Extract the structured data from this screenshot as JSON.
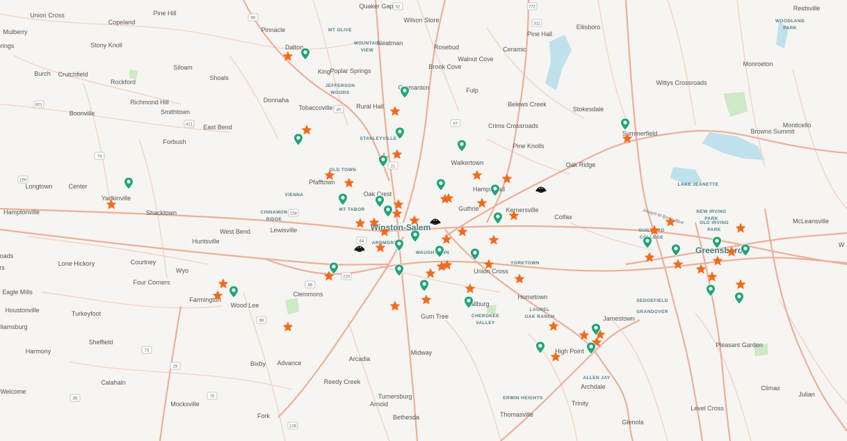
{
  "colors": {
    "background": "#f6f5f2",
    "road": "#f1c7b4",
    "highway": "#edae98",
    "water": "#bfe1ec",
    "park": "#cde9c5",
    "star": "#f26a1b",
    "pin": "#23a477",
    "pin_inner": "#ffffff",
    "bowl": "#111111",
    "neighborhood": "#4f7e85"
  },
  "cities": [
    {
      "name": "Winston-Salem"
    },
    {
      "name": "Greensboro"
    }
  ],
  "towns": [
    {
      "name": "Union Cross"
    },
    {
      "name": "Quaker Gap"
    },
    {
      "name": "Wilson Store"
    },
    {
      "name": "Reidsville"
    },
    {
      "name": "Mulberry"
    },
    {
      "name": "Copeland"
    },
    {
      "name": "Pine Hill"
    },
    {
      "name": "Pinnacle"
    },
    {
      "name": "Pine Hall"
    },
    {
      "name": "Ellisboro"
    },
    {
      "name": "prings"
    },
    {
      "name": "Stony Knoll"
    },
    {
      "name": "Dalton"
    },
    {
      "name": "Neatman"
    },
    {
      "name": "Rosebud"
    },
    {
      "name": "Ceramic"
    },
    {
      "name": "King"
    },
    {
      "name": "Poplar Springs"
    },
    {
      "name": "Walnut Cove"
    },
    {
      "name": "Brook Cove"
    },
    {
      "name": "Monroeton"
    },
    {
      "name": "Burch"
    },
    {
      "name": "Crutchfield"
    },
    {
      "name": "Siloam"
    },
    {
      "name": "Shoals"
    },
    {
      "name": "Rockford"
    },
    {
      "name": "Wittys Crossroads"
    },
    {
      "name": "Germanton"
    },
    {
      "name": "Fulp"
    },
    {
      "name": "Richmond Hill"
    },
    {
      "name": "Donnaha"
    },
    {
      "name": "Rural Hall"
    },
    {
      "name": "Tobaccoville"
    },
    {
      "name": "Belews Creek"
    },
    {
      "name": "Stokesdale"
    },
    {
      "name": "Boonville"
    },
    {
      "name": "Smithtown"
    },
    {
      "name": "Crims Crossroads"
    },
    {
      "name": "East Bend"
    },
    {
      "name": "Summerfield"
    },
    {
      "name": "Browns Summit"
    },
    {
      "name": "Monticello"
    },
    {
      "name": "Forbush"
    },
    {
      "name": "Pine Knolls"
    },
    {
      "name": "Walkertown"
    },
    {
      "name": "Oak Ridge"
    },
    {
      "name": "Longtown"
    },
    {
      "name": "Center"
    },
    {
      "name": "Yadkinville"
    },
    {
      "name": "Pfafftown"
    },
    {
      "name": "Hampstead"
    },
    {
      "name": "Oak Crest"
    },
    {
      "name": "Guthrie"
    },
    {
      "name": "Hamptonville"
    },
    {
      "name": "Shacktown"
    },
    {
      "name": "Kernersville"
    },
    {
      "name": "Colfax"
    },
    {
      "name": "McLeansville"
    },
    {
      "name": "Lewisville"
    },
    {
      "name": "West Bend"
    },
    {
      "name": "Huntsville"
    },
    {
      "name": "Lone Hickory"
    },
    {
      "name": "Courtney"
    },
    {
      "name": "Wyo"
    },
    {
      "name": "Four Corners"
    },
    {
      "name": "Union Cross"
    },
    {
      "name": "Eagle Mills"
    },
    {
      "name": "Clemmons"
    },
    {
      "name": "Hometown"
    },
    {
      "name": "Farmington"
    },
    {
      "name": "Wood Lee"
    },
    {
      "name": "Houstonville"
    },
    {
      "name": "Turkeyfoot"
    },
    {
      "name": "illiamsburg"
    },
    {
      "name": "Gum Tree"
    },
    {
      "name": "Jamestown"
    },
    {
      "name": "Sheffield"
    },
    {
      "name": "High Point"
    },
    {
      "name": "Pleasant Garden"
    },
    {
      "name": "Harmony"
    },
    {
      "name": "Bixby"
    },
    {
      "name": "Advance"
    },
    {
      "name": "Midway"
    },
    {
      "name": "Arcadia"
    },
    {
      "name": "Archdale"
    },
    {
      "name": "Climax"
    },
    {
      "name": "Calahaln"
    },
    {
      "name": "Reedy Creek"
    },
    {
      "name": "Turnersburg"
    },
    {
      "name": "Welcome"
    },
    {
      "name": "Julian"
    },
    {
      "name": "Mocksville"
    },
    {
      "name": "Arnold"
    },
    {
      "name": "Trinity"
    },
    {
      "name": "Level Cross"
    },
    {
      "name": "Fork"
    },
    {
      "name": "Bethesda"
    },
    {
      "name": "Thomasville"
    },
    {
      "name": "Glenola"
    },
    {
      "name": "Wallburg"
    },
    {
      "name": "W"
    },
    {
      "name": "roads"
    },
    {
      "name": "rs"
    }
  ],
  "neighborhoods": [
    {
      "name": "MT OLIVE"
    },
    {
      "name": "MOUNTAIN\nVIEW"
    },
    {
      "name": "WOODLAND\nPARK"
    },
    {
      "name": "JEFFERSON\nWOODS"
    },
    {
      "name": "STANLEYVILLE"
    },
    {
      "name": "OLD TOWN"
    },
    {
      "name": "VIENNA"
    },
    {
      "name": "LAKE JEANETTE"
    },
    {
      "name": "MT TABOR"
    },
    {
      "name": "NEW IRVING\nPARK"
    },
    {
      "name": "CINNAMON\nRIDGE"
    },
    {
      "name": "OLD IRVING\nPARK"
    },
    {
      "name": "GUILFORD\nCOLLEGE"
    },
    {
      "name": "ARDMORE"
    },
    {
      "name": "WAUGHTOWN"
    },
    {
      "name": "YORKTOWN"
    },
    {
      "name": "SEDGEFIELD"
    },
    {
      "name": "GRANDOVER"
    },
    {
      "name": "LAUREL\nOAK RANCH"
    },
    {
      "name": "CHEROKEE\nVALLEY"
    },
    {
      "name": "ALLEN JAY"
    },
    {
      "name": "ERWIN HEIGHTS"
    }
  ],
  "road_labels": [
    {
      "name": "Joseph M Bryan Blvd"
    }
  ],
  "route_shields": [
    "52",
    "772",
    "311",
    "65",
    "67",
    "21",
    "601",
    "421",
    "40",
    "150",
    "74",
    "158",
    "64",
    "66",
    "220",
    "68",
    "29",
    "73",
    "85",
    "70",
    "109"
  ],
  "markers": {
    "star_icon": "star-icon",
    "pin_icon": "location-pin-icon",
    "bowl_icon": "bowl-icon",
    "star_count": 61,
    "pin_count": 32,
    "bowl_count": 4
  }
}
